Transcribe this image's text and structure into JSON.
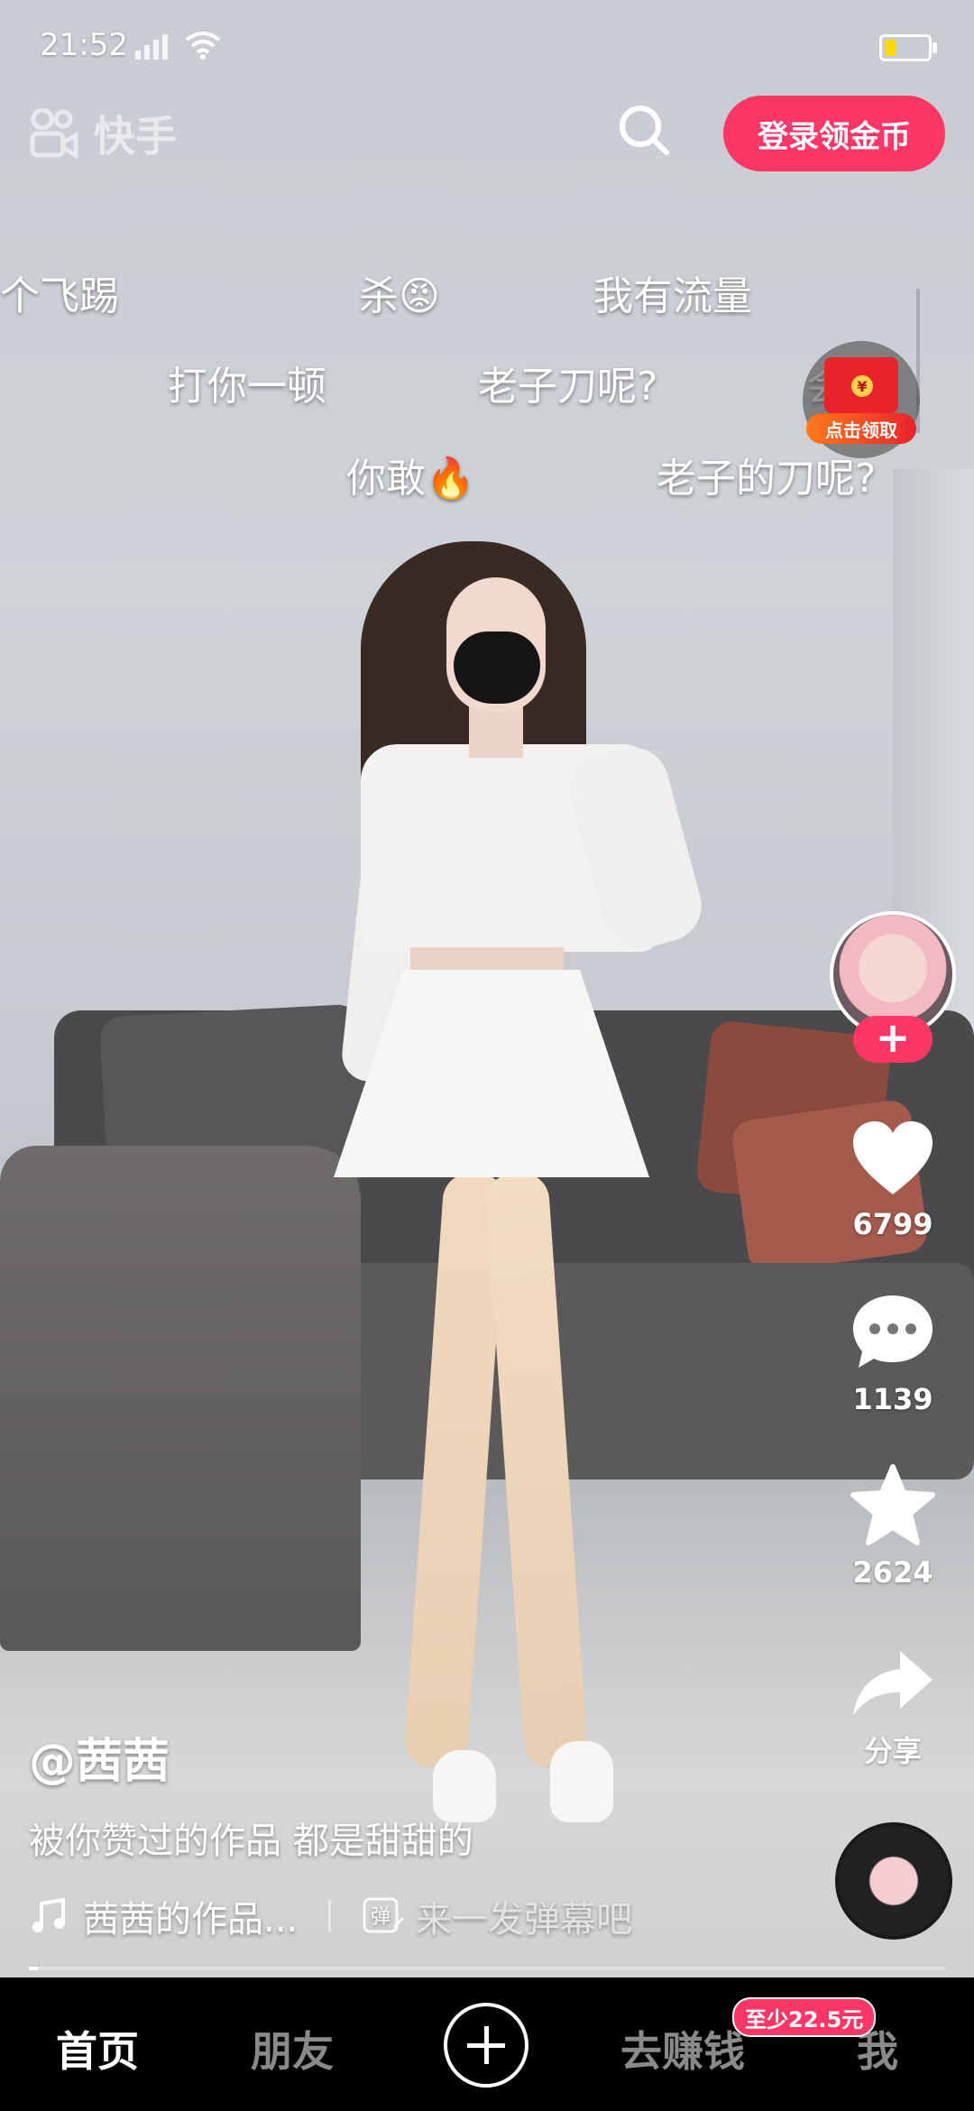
{
  "status_bar": {
    "time": "21:52"
  },
  "header": {
    "logo_text": "快手",
    "login_label": "登录领金币"
  },
  "danmaku": [
    "个飞踢",
    "杀😡",
    "我有流量",
    "打你一顿",
    "老子刀呢?",
    "会",
    "你敢🔥",
    "老子的刀呢?"
  ],
  "red_packet": {
    "label": "点击领取",
    "coin_symbol": "¥"
  },
  "actions": {
    "follow_label": "+",
    "likes": "6799",
    "comments": "1139",
    "favorites": "2624",
    "share_label": "分享"
  },
  "video_info": {
    "author": "@茜茜",
    "caption": "被你赞过的作品 都是甜甜的",
    "music": "茜茜的作品...",
    "danmaku_placeholder": "来一发弹幕吧",
    "danmaku_icon_char": "弹",
    "progress": 0.01
  },
  "tabbar": {
    "home": "首页",
    "friends": "朋友",
    "earn": "去赚钱",
    "earn_badge": "至少22.5元",
    "me": "我"
  },
  "colors": {
    "accent": "#fe3666",
    "tab_active": "#ffffff",
    "tab_inactive": "#8a8a8a"
  },
  "icons": [
    "search-icon",
    "heart-icon",
    "comment-icon",
    "star-icon",
    "share-icon",
    "music-note-icon",
    "plus-icon"
  ]
}
